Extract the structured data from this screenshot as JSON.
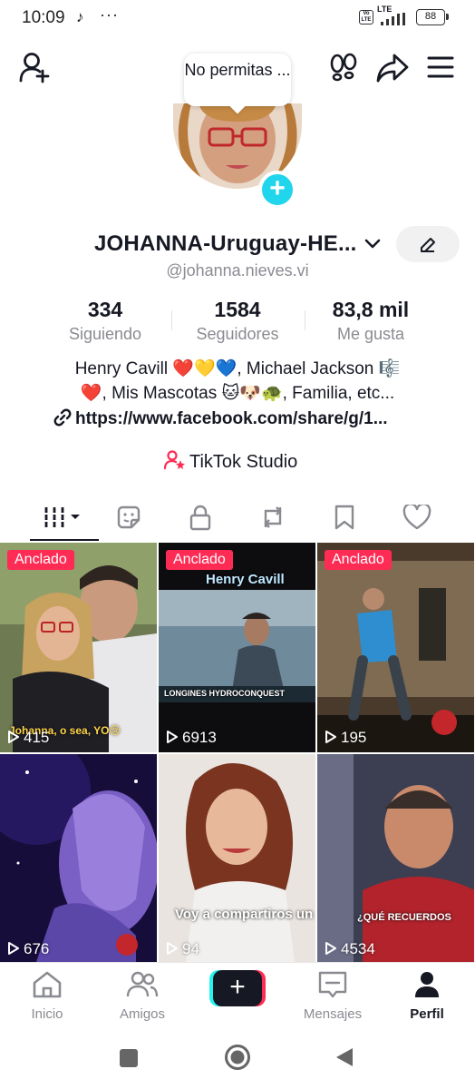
{
  "status_bar": {
    "time": "10:09",
    "tiktok_glyph": "♪",
    "more": "···",
    "volte": "Vo LTE",
    "network": "LTE",
    "battery": "88"
  },
  "tooltip": {
    "text": "No permitas ..."
  },
  "profile": {
    "name": "JOHANNA-Uruguay-HE...",
    "handle": "@johanna.nieves.vi",
    "stats": [
      {
        "num": "334",
        "label": "Siguiendo"
      },
      {
        "num": "1584",
        "label": "Seguidores"
      },
      {
        "num": "83,8 mil",
        "label": "Me gusta"
      }
    ],
    "bio_line1": "Henry Cavill ❤️💛💙, Michael Jackson 🎼",
    "bio_line2": "❤️, Mis Mascotas 🐱🐶🐢, Familia, etc...",
    "link": "https://www.facebook.com/share/g/1...",
    "studio": "TikTok Studio"
  },
  "tabs": [
    "videos-tab",
    "reposts-sticker-tab",
    "private-tab",
    "repost-tab",
    "favorites-tab",
    "liked-tab"
  ],
  "videos": [
    {
      "pinned": "Anclado",
      "views": "415",
      "overlay": "Johanna, o sea, YO😢"
    },
    {
      "pinned": "Anclado",
      "views": "6913",
      "overlay": "Henry Cavill",
      "caption": "LONGINES HYDROCONQUEST"
    },
    {
      "pinned": "Anclado",
      "views": "195",
      "overlay": ""
    },
    {
      "pinned": "",
      "views": "676",
      "overlay": ""
    },
    {
      "pinned": "",
      "views": "94",
      "overlay": "Voy a compartiros un poquito"
    },
    {
      "pinned": "",
      "views": "4534",
      "overlay": "¿QUÉ RECUERDOS"
    }
  ],
  "nav": {
    "home": "Inicio",
    "friends": "Amigos",
    "create": "+",
    "inbox": "Mensajes",
    "profile": "Perfil"
  },
  "colors": {
    "accent": "#fe2c55",
    "cyan": "#20d5ec",
    "text": "#161823",
    "muted": "#8a8b91"
  }
}
